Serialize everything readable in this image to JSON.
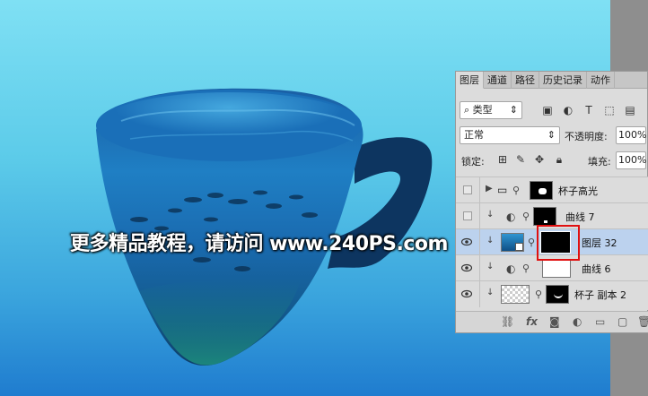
{
  "watermark": {
    "text": "更多精品教程，请访问 ",
    "url": "www.240PS.com"
  },
  "panel": {
    "tabs": [
      "图层",
      "通道",
      "路径",
      "历史记录",
      "动作"
    ],
    "filter_kind": "类型",
    "blend_mode": "正常",
    "opacity_label": "不透明度:",
    "opacity_value": "100%",
    "lock_label": "锁定:",
    "fill_label": "填充:",
    "fill_value": "100%",
    "layers": [
      {
        "name": "杯子高光",
        "type": "group"
      },
      {
        "name": "曲线 7",
        "type": "curves"
      },
      {
        "name": "图层 32",
        "type": "smart"
      },
      {
        "name": "曲线 6",
        "type": "curves"
      },
      {
        "name": "杯子 副本 2",
        "type": "pixel"
      }
    ]
  },
  "colors": {
    "selected_layer": "#bcd2ee",
    "highlight_box": "#e01010"
  }
}
